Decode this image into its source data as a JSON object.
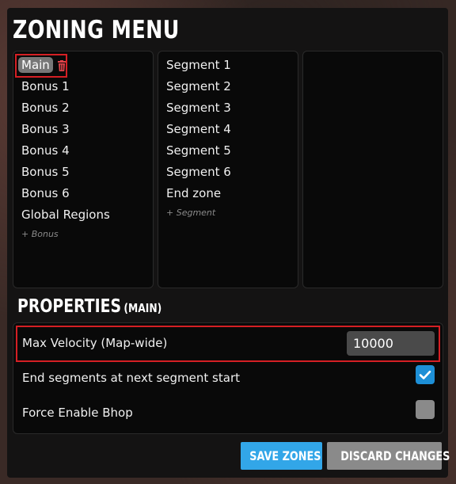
{
  "title": "ZONING MENU",
  "tracks": {
    "selected": "Main",
    "items": [
      "Main",
      "Bonus 1",
      "Bonus 2",
      "Bonus 3",
      "Bonus 4",
      "Bonus 5",
      "Bonus 6",
      "Global Regions"
    ],
    "add_label": "+ Bonus"
  },
  "segments": {
    "items": [
      "Segment 1",
      "Segment 2",
      "Segment 3",
      "Segment 4",
      "Segment 5",
      "Segment 6",
      "End zone"
    ],
    "add_label": "+ Segment"
  },
  "properties": {
    "title": "PROPERTIES",
    "context": "(MAIN)",
    "max_velocity_label": "Max Velocity (Map-wide)",
    "max_velocity_value": "10000",
    "end_segments_label": "End segments at next segment start",
    "end_segments_checked": true,
    "force_bhop_label": "Force Enable Bhop",
    "force_bhop_checked": false
  },
  "buttons": {
    "save": "SAVE ZONES",
    "discard": "DISCARD CHANGES"
  },
  "colors": {
    "accent_blue": "#32a6e8",
    "checkbox_on": "#1d8fd6",
    "highlight_red": "#d51f24",
    "delete_red": "#e0444a"
  }
}
